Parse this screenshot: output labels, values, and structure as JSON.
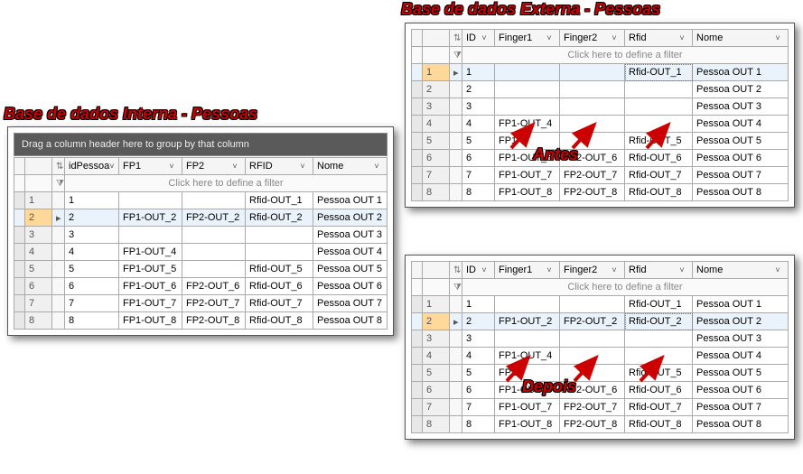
{
  "titles": {
    "interna": "Base de dados Interna - Pessoas",
    "externa": "Base de dados Externa - Pessoas",
    "antes": "Antes",
    "depois": "Depois"
  },
  "common": {
    "group_text": "Drag a column header here to group by that column",
    "filter_text": "Click here to define a filter"
  },
  "interna": {
    "columns": [
      "idPessoa",
      "FP1",
      "FP2",
      "RFID",
      "Nome"
    ],
    "selected_row": 2,
    "rows": [
      {
        "n": 1,
        "id": "1",
        "fp1": "",
        "fp2": "",
        "rfid": "Rfid-OUT_1",
        "nome": "Pessoa OUT 1"
      },
      {
        "n": 2,
        "id": "2",
        "fp1": "FP1-OUT_2",
        "fp2": "FP2-OUT_2",
        "rfid": "Rfid-OUT_2",
        "nome": "Pessoa OUT 2"
      },
      {
        "n": 3,
        "id": "3",
        "fp1": "",
        "fp2": "",
        "rfid": "",
        "nome": "Pessoa OUT 3"
      },
      {
        "n": 4,
        "id": "4",
        "fp1": "FP1-OUT_4",
        "fp2": "",
        "rfid": "",
        "nome": "Pessoa OUT 4"
      },
      {
        "n": 5,
        "id": "5",
        "fp1": "FP1-OUT_5",
        "fp2": "",
        "rfid": "Rfid-OUT_5",
        "nome": "Pessoa OUT 5"
      },
      {
        "n": 6,
        "id": "6",
        "fp1": "FP1-OUT_6",
        "fp2": "FP2-OUT_6",
        "rfid": "Rfid-OUT_6",
        "nome": "Pessoa OUT 6"
      },
      {
        "n": 7,
        "id": "7",
        "fp1": "FP1-OUT_7",
        "fp2": "FP2-OUT_7",
        "rfid": "Rfid-OUT_7",
        "nome": "Pessoa OUT 7"
      },
      {
        "n": 8,
        "id": "8",
        "fp1": "FP1-OUT_8",
        "fp2": "FP2-OUT_8",
        "rfid": "Rfid-OUT_8",
        "nome": "Pessoa OUT 8"
      }
    ]
  },
  "externa": {
    "columns": [
      "ID",
      "Finger1",
      "Finger2",
      "Rfid",
      "Nome"
    ]
  },
  "antes": {
    "selected_row": 1,
    "rows": [
      {
        "n": 1,
        "id": "1",
        "fp1": "",
        "fp2": "",
        "rfid": "Rfid-OUT_1",
        "nome": "Pessoa OUT 1"
      },
      {
        "n": 2,
        "id": "2",
        "fp1": "",
        "fp2": "",
        "rfid": "",
        "nome": "Pessoa OUT 2"
      },
      {
        "n": 3,
        "id": "3",
        "fp1": "",
        "fp2": "",
        "rfid": "",
        "nome": "Pessoa OUT 3"
      },
      {
        "n": 4,
        "id": "4",
        "fp1": "FP1-OUT_4",
        "fp2": "",
        "rfid": "",
        "nome": "Pessoa OUT 4"
      },
      {
        "n": 5,
        "id": "5",
        "fp1": "FP1",
        "fp2": "",
        "rfid": "Rfid-OUT_5",
        "nome": "Pessoa OUT 5"
      },
      {
        "n": 6,
        "id": "6",
        "fp1": "FP1-OUT_6",
        "fp2": "FP2-OUT_6",
        "rfid": "Rfid-OUT_6",
        "nome": "Pessoa OUT 6"
      },
      {
        "n": 7,
        "id": "7",
        "fp1": "FP1-OUT_7",
        "fp2": "FP2-OUT_7",
        "rfid": "Rfid-OUT_7",
        "nome": "Pessoa OUT 7"
      },
      {
        "n": 8,
        "id": "8",
        "fp1": "FP1-OUT_8",
        "fp2": "FP2-OUT_8",
        "rfid": "Rfid-OUT_8",
        "nome": "Pessoa OUT 8"
      }
    ]
  },
  "depois": {
    "selected_row": 2,
    "rows": [
      {
        "n": 1,
        "id": "1",
        "fp1": "",
        "fp2": "",
        "rfid": "Rfid-OUT_1",
        "nome": "Pessoa OUT 1"
      },
      {
        "n": 2,
        "id": "2",
        "fp1": "FP1-OUT_2",
        "fp2": "FP2-OUT_2",
        "rfid": "Rfid-OUT_2",
        "nome": "Pessoa OUT 2"
      },
      {
        "n": 3,
        "id": "3",
        "fp1": "",
        "fp2": "",
        "rfid": "",
        "nome": "Pessoa OUT 3"
      },
      {
        "n": 4,
        "id": "4",
        "fp1": "FP1-OUT_4",
        "fp2": "",
        "rfid": "",
        "nome": "Pessoa OUT 4"
      },
      {
        "n": 5,
        "id": "5",
        "fp1": "FP1",
        "fp2": "",
        "rfid": "Rfid-OUT_5",
        "nome": "Pessoa OUT 5"
      },
      {
        "n": 6,
        "id": "6",
        "fp1": "FP1-OUT_6",
        "fp2": "FP2-OUT_6",
        "rfid": "Rfid-OUT_6",
        "nome": "Pessoa OUT 6"
      },
      {
        "n": 7,
        "id": "7",
        "fp1": "FP1-OUT_7",
        "fp2": "FP2-OUT_7",
        "rfid": "Rfid-OUT_7",
        "nome": "Pessoa OUT 7"
      },
      {
        "n": 8,
        "id": "8",
        "fp1": "FP1-OUT_8",
        "fp2": "FP2-OUT_8",
        "rfid": "Rfid-OUT_8",
        "nome": "Pessoa OUT 8"
      }
    ]
  },
  "colors": {
    "accent": "#c00",
    "selection": "#eaf3fb",
    "rownum_selected": "#ffd89a"
  }
}
